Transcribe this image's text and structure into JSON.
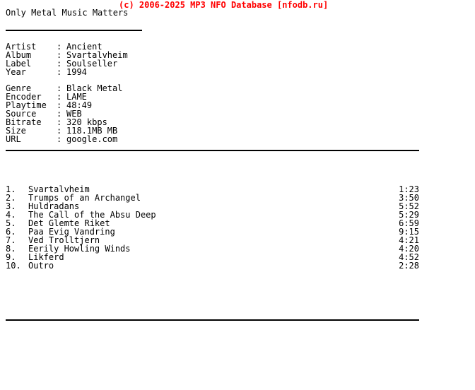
{
  "header": {
    "copyright": "(c) 2006-2025 MP3 NFO Database [nfodb.ru]",
    "copyright_color": "#ff0000",
    "slogan": "Only Metal Music Matters"
  },
  "release_info": {
    "primary": [
      {
        "label": "Artist",
        "separator": ":",
        "value": "Ancient"
      },
      {
        "label": "Album",
        "separator": ":",
        "value": "Svartalvheim"
      },
      {
        "label": "Label",
        "separator": ":",
        "value": "Soulseller"
      },
      {
        "label": "Year",
        "separator": ":",
        "value": "1994"
      }
    ],
    "technical": [
      {
        "label": "Genre",
        "separator": ":",
        "value": "Black Metal"
      },
      {
        "label": "Encoder",
        "separator": ":",
        "value": "LAME"
      },
      {
        "label": "Playtime",
        "separator": ":",
        "value": "48:49"
      },
      {
        "label": "Source",
        "separator": ":",
        "value": "WEB"
      },
      {
        "label": "Bitrate",
        "separator": ":",
        "value": "320 kbps"
      },
      {
        "label": "Size",
        "separator": ":",
        "value": "118.1MB MB"
      },
      {
        "label": "URL",
        "separator": ":",
        "value": "google.com"
      }
    ]
  },
  "tracklist": [
    {
      "num": "1.",
      "title": "Svartalvheim",
      "time": "1:23"
    },
    {
      "num": "2.",
      "title": "Trumps of an Archangel",
      "time": "3:50"
    },
    {
      "num": "3.",
      "title": "Huldradans",
      "time": "5:52"
    },
    {
      "num": "4.",
      "title": "The Call of the Absu Deep",
      "time": "5:29"
    },
    {
      "num": "5.",
      "title": "Det Glemte Riket",
      "time": "6:59"
    },
    {
      "num": "6.",
      "title": "Paa Evig Vandring",
      "time": "9:15"
    },
    {
      "num": "7.",
      "title": "Ved Trolltjern",
      "time": "4:21"
    },
    {
      "num": "8.",
      "title": "Eerily Howling Winds",
      "time": "4:20"
    },
    {
      "num": "9.",
      "title": "Likferd",
      "time": "4:52"
    },
    {
      "num": "10.",
      "title": "Outro",
      "time": "2:28"
    }
  ]
}
